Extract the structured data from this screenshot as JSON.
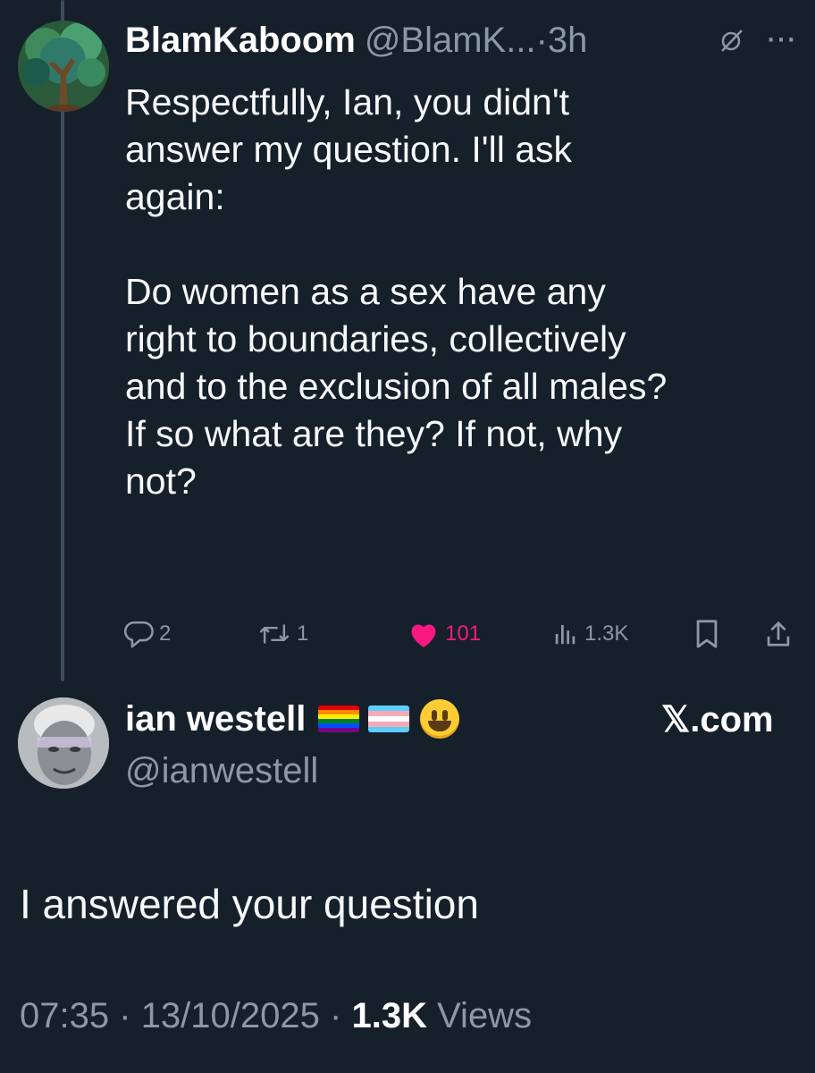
{
  "reply_tweet": {
    "author_name": "BlamKaboom",
    "author_handle": "@BlamK...",
    "dot": "·",
    "time": "3h",
    "body_lines": [
      "Respectfully, Ian, you didn't",
      "answer my question. I'll ask",
      "again:"
    ],
    "body_lines_2": [
      "Do women as a sex have any",
      "right to boundaries, collectively",
      "and to the exclusion of all males?",
      "If so what are they? If not, why",
      "not?"
    ],
    "actions": {
      "replies": "2",
      "reposts": "1",
      "likes": "101",
      "views": "1.3K"
    },
    "like_color": "#f91880"
  },
  "main_tweet": {
    "author_name": "ian westell",
    "author_handle": "@ianwestell",
    "badge_icons": [
      "rainbow-flag-icon",
      "transgender-flag-icon",
      "smiley-emoji-icon"
    ],
    "source_label": "𝕏.com",
    "body": "I answered your question",
    "time": "07:35",
    "separator": "·",
    "date": "13/10/2025",
    "views_count": "1.3K",
    "views_label": "Views"
  },
  "colors": {
    "background": "#15202b",
    "secondary_text": "#8b98a5",
    "thread_line": "#3e4d5c"
  }
}
